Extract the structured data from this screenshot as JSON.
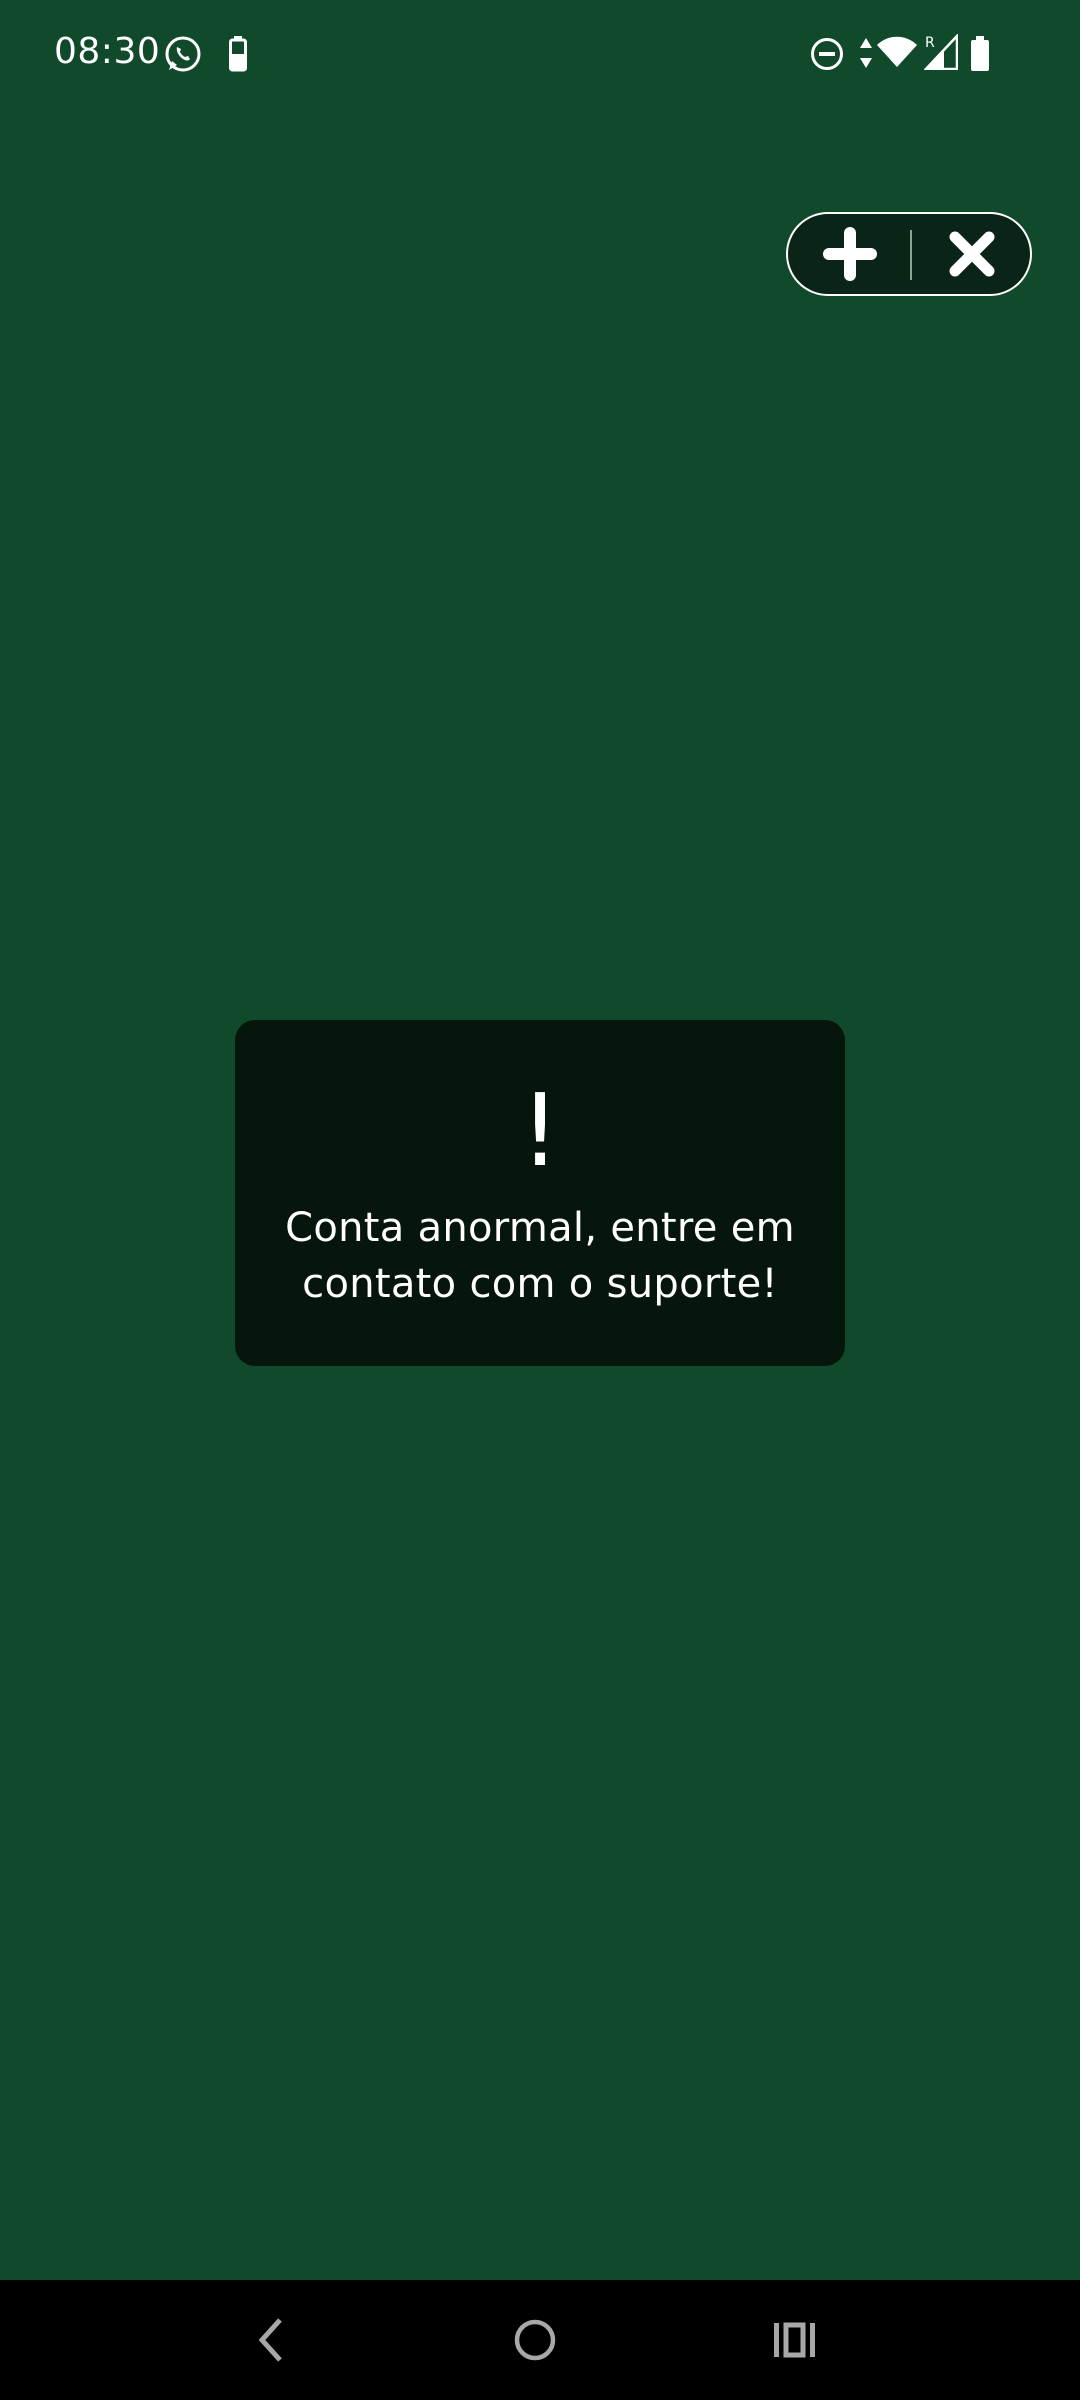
{
  "status_bar": {
    "time": "08:30",
    "icons": [
      "whatsapp-icon",
      "battery-saver-icon",
      "do-not-disturb-icon",
      "data-arrows-icon",
      "wifi-icon",
      "signal-roaming-icon",
      "battery-icon"
    ],
    "roaming_label": "R"
  },
  "floating_control": {
    "add_icon": "plus-icon",
    "close_icon": "close-icon"
  },
  "toast": {
    "mark": "!",
    "message_line1": "Conta anormal, entre em",
    "message_line2": "contato com o suporte!"
  },
  "nav_bar": {
    "back_icon": "back-chevron-icon",
    "home_icon": "home-circle-icon",
    "recents_icon": "recents-icon"
  },
  "colors": {
    "background": "#114a2a",
    "toast_background": "#06160d",
    "pill_background": "#0a2418",
    "nav_background": "#000000",
    "text": "#ffffff"
  }
}
